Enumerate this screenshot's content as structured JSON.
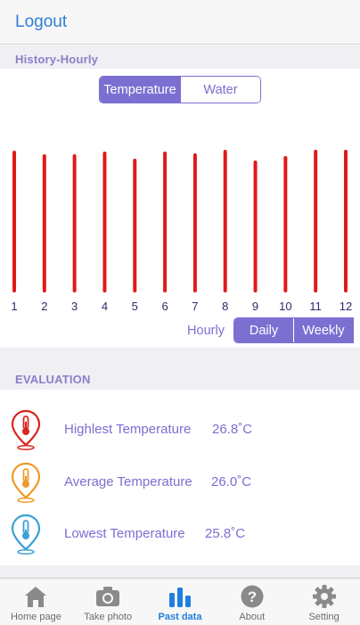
{
  "topbar": {
    "logout_label": "Logout"
  },
  "history": {
    "header": "History-Hourly",
    "tabs": [
      {
        "label": "Temperature",
        "active": true
      },
      {
        "label": "Water",
        "active": false
      }
    ]
  },
  "chart_data": {
    "type": "bar",
    "categories": [
      "1",
      "2",
      "3",
      "4",
      "5",
      "6",
      "7",
      "8",
      "9",
      "10",
      "11",
      "12"
    ],
    "values": [
      155,
      151,
      151,
      154,
      146,
      154,
      152,
      156,
      144,
      149,
      156,
      156
    ],
    "bar_color": "#e01a1a",
    "title": "",
    "xlabel": "",
    "ylabel": ""
  },
  "range": {
    "options": [
      {
        "label": "Hourly",
        "active": false
      },
      {
        "label": "Daily",
        "active": true
      },
      {
        "label": "Weekly",
        "active": true
      }
    ]
  },
  "evaluation": {
    "header": "EVALUATION",
    "rows": [
      {
        "label": "Highlest Temperature",
        "value": "26.8˚C",
        "icon": "red-thermometer-pin-icon",
        "color": "#d9261c"
      },
      {
        "label": "Average Temperature",
        "value": "26.0˚C",
        "icon": "orange-thermometer-pin-icon",
        "color": "#ee9a2a"
      },
      {
        "label": "Lowest Temperature",
        "value": "25.8˚C",
        "icon": "blue-thermometer-pin-icon",
        "color": "#3aa0d8"
      }
    ]
  },
  "tabbar": {
    "items": [
      {
        "label": "Home page",
        "icon": "home-icon",
        "active": false
      },
      {
        "label": "Take photo",
        "icon": "camera-icon",
        "active": false
      },
      {
        "label": "Past data",
        "icon": "bar-chart-icon",
        "active": true
      },
      {
        "label": "About",
        "icon": "question-icon",
        "active": false
      },
      {
        "label": "Setting",
        "icon": "gear-icon",
        "active": false
      }
    ]
  },
  "colors": {
    "accent": "#7b6fd1",
    "link": "#2f7fd6",
    "active_tab": "#1f7fe0",
    "section_bg": "#efeff4"
  }
}
